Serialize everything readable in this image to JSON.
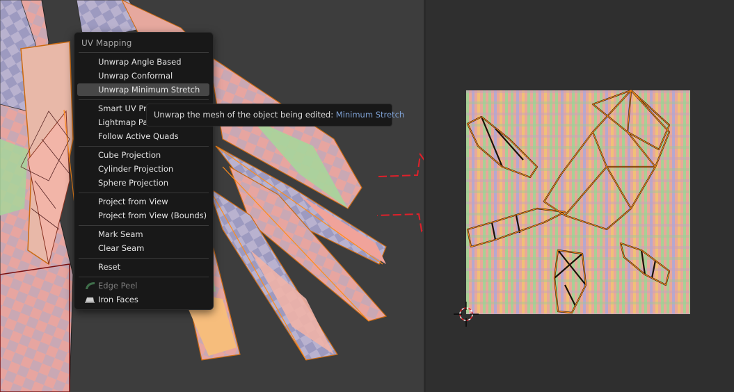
{
  "menu": {
    "title": "UV Mapping",
    "items": [
      {
        "label": "Unwrap Angle Based"
      },
      {
        "label": "Unwrap Conformal"
      },
      {
        "label": "Unwrap Minimum Stretch"
      },
      {
        "label": "Smart UV Project"
      },
      {
        "label": "Lightmap Pack"
      },
      {
        "label": "Follow Active Quads"
      },
      {
        "label": "Cube Projection"
      },
      {
        "label": "Cylinder Projection"
      },
      {
        "label": "Sphere Projection"
      },
      {
        "label": "Project from View"
      },
      {
        "label": "Project from View (Bounds)"
      },
      {
        "label": "Mark Seam"
      },
      {
        "label": "Clear Seam"
      },
      {
        "label": "Reset"
      },
      {
        "label": "Edge Peel",
        "icon": "edge-peel-icon",
        "disabled": true
      },
      {
        "label": "Iron Faces",
        "icon": "iron-icon"
      }
    ],
    "active_item": "Unwrap Minimum Stretch"
  },
  "tooltip": {
    "text": "Unwrap the mesh of the object being edited:",
    "highlight": "Minimum Stretch"
  },
  "annotation": {
    "icon": "right-arrow-icon",
    "color": "#e0202a"
  },
  "colors": {
    "menu_bg": "#181818",
    "active_item_bg": "#474747",
    "tooltip_highlight": "#7fa2d6",
    "uv_edges": "#ff8c1a",
    "viewport_bg": "#3d3d3d",
    "uv_editor_bg": "#2f2f2f"
  }
}
